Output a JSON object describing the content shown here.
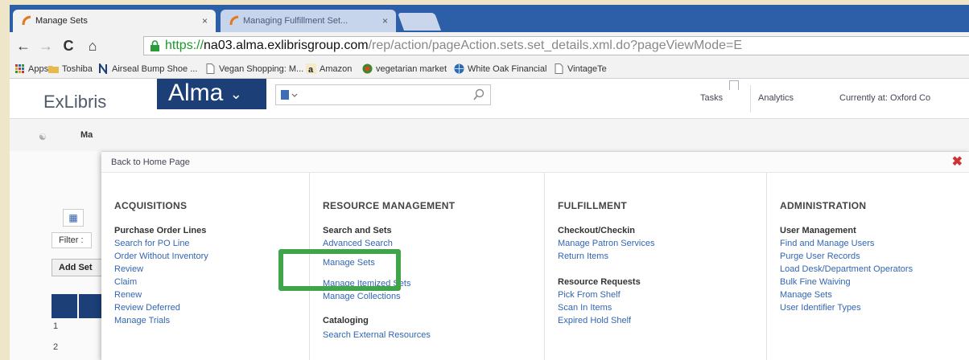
{
  "browser": {
    "tabs": [
      {
        "title": "Manage Sets",
        "close": "×"
      },
      {
        "title": "Managing Fulfillment Set...",
        "close": "×"
      }
    ],
    "url": {
      "protocol": "https://",
      "host": "na03.alma.exlibrisgroup.com",
      "path": "/rep/action/pageAction.sets.set_details.xml.do?pageViewMode=E"
    },
    "bookmarks": [
      {
        "label": "Apps",
        "icon": "apps-grid-icon"
      },
      {
        "label": "Toshiba",
        "icon": "folder-icon"
      },
      {
        "label": "Airseal Bump Shoe ...",
        "icon": "n-brand-icon"
      },
      {
        "label": "Vegan Shopping: M...",
        "icon": "page-icon"
      },
      {
        "label": "Amazon",
        "icon": "amazon-icon"
      },
      {
        "label": "vegetarian market",
        "icon": "veg-market-icon"
      },
      {
        "label": "White Oak Financial",
        "icon": "globe-icon"
      },
      {
        "label": "VintageTe",
        "icon": "page-icon"
      }
    ]
  },
  "alma_header": {
    "vendor": "ExLibris",
    "product": "Alma",
    "search_placeholder": "",
    "tasks": "Tasks",
    "analytics": "Analytics",
    "currently_at": "Currently at: Oxford Co"
  },
  "background_page": {
    "page_tab": "Ma",
    "filter_label": "Filter :",
    "add_set": "Add Set",
    "row_numbers": [
      "1",
      "2"
    ]
  },
  "menu": {
    "back_link": "Back to Home Page",
    "close": "✖",
    "columns": [
      {
        "title": "ACQUISITIONS",
        "groups": [
          {
            "name": "Purchase Order Lines",
            "links": [
              "Search for PO Line",
              "Order Without Inventory",
              "Review",
              "Claim",
              "Renew",
              "Review Deferred",
              "Manage Trials"
            ]
          }
        ]
      },
      {
        "title": "RESOURCE MANAGEMENT",
        "groups": [
          {
            "name": "Search and Sets",
            "links": [
              "Advanced Search",
              "Manage Sets",
              "Manage Itemized Sets",
              "Manage Collections"
            ]
          },
          {
            "name": "Cataloging",
            "links": [
              "Search External Resources"
            ]
          }
        ]
      },
      {
        "title": "FULFILLMENT",
        "groups": [
          {
            "name": "Checkout/Checkin",
            "links": [
              "Manage Patron Services",
              "Return Items"
            ]
          },
          {
            "name": "Resource Requests",
            "links": [
              "Pick From Shelf",
              "Scan In Items",
              "Expired Hold Shelf"
            ]
          }
        ]
      },
      {
        "title": "ADMINISTRATION",
        "groups": [
          {
            "name": "User Management",
            "links": [
              "Find and Manage Users",
              "Purge User Records",
              "Load Desk/Department Operators",
              "Bulk Fine Waiving",
              "Manage Sets",
              "User Identifier Types"
            ]
          }
        ]
      }
    ]
  },
  "highlight_color": "#3fa44a",
  "brand_color": "#1c3f78"
}
